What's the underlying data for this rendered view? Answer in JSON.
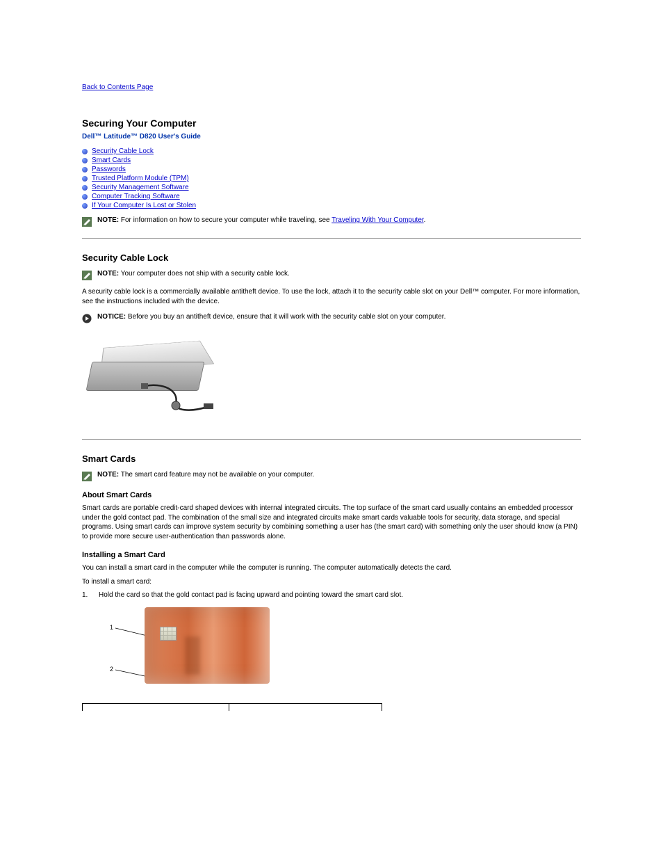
{
  "nav": {
    "back_label": "Back to Contents Page"
  },
  "header": {
    "title": "Securing Your Computer",
    "subtitle": "Dell™ Latitude™ D820  User's Guide"
  },
  "toc": [
    {
      "label": "Security Cable Lock"
    },
    {
      "label": "Smart Cards"
    },
    {
      "label": "Passwords"
    },
    {
      "label": "Trusted Platform Module (TPM)"
    },
    {
      "label": "Security Management Software"
    },
    {
      "label": "Computer Tracking Software"
    },
    {
      "label": "If Your Computer Is Lost or Stolen"
    }
  ],
  "note_intro": {
    "prefix": "NOTE:",
    "text_a": " For information on how to secure your computer while traveling, see ",
    "link": "Traveling With Your Computer",
    "text_b": "."
  },
  "section_lock": {
    "title": "Security Cable Lock",
    "note": {
      "prefix": "NOTE:",
      "text": " Your computer does not ship with a security cable lock."
    },
    "body": "A security cable lock is a commercially available antitheft device. To use the lock, attach it to the security cable slot on your Dell™ computer. For more information, see the instructions included with the device.",
    "notice": {
      "prefix": "NOTICE:",
      "text": " Before you buy an antitheft device, ensure that it will work with the security cable slot on your computer."
    }
  },
  "section_smart": {
    "title": "Smart Cards",
    "note": {
      "prefix": "NOTE:",
      "text": " The smart card feature may not be available on your computer."
    },
    "about_title": "About Smart Cards",
    "about_p1": "Smart cards are portable credit-card shaped devices with internal integrated circuits. The top surface of the smart card usually contains an embedded processor under the gold contact pad. The combination of the small size and integrated circuits make smart cards valuable tools for security, data storage, and special programs. Using smart cards can improve system security by combining something a user has (the smart card) with something only the user should know (a PIN) to provide more secure user-authentication than passwords alone.",
    "install_title": "Installing a Smart Card",
    "install_p1": "You can install a smart card in the computer while the computer is running. The computer automatically detects the card.",
    "install_p2": "To install a smart card:",
    "step1": "Hold the card so that the gold contact pad is facing upward and pointing toward the smart card slot.",
    "step1_num": "1.",
    "callout1": "1",
    "callout2": "2"
  }
}
